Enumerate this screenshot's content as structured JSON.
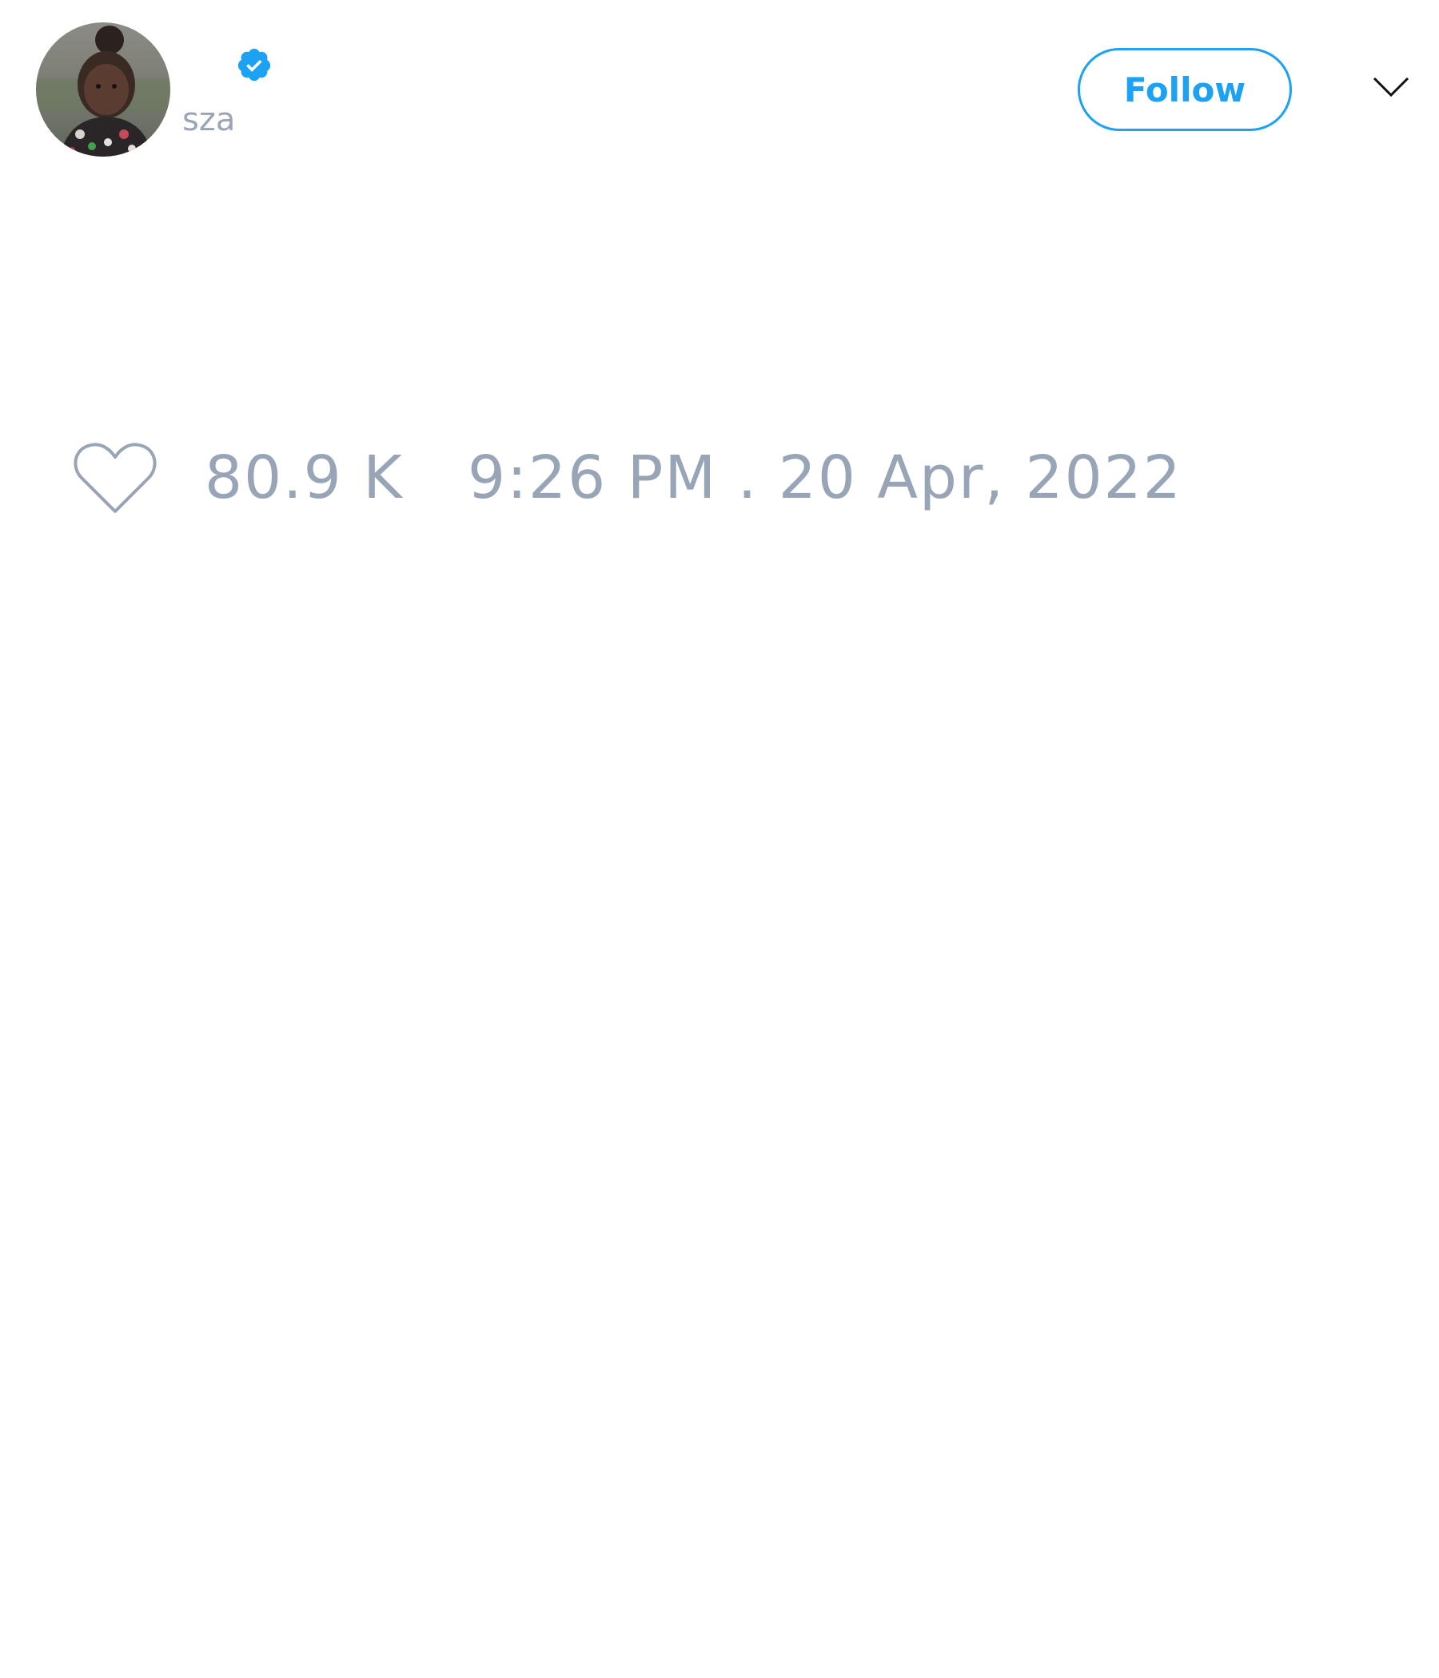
{
  "tweet": {
    "author": {
      "handle": "sza",
      "verified": true,
      "avatar_icon": "profile-photo"
    },
    "follow_button_label": "Follow",
    "menu_icon": "chevron-down-icon",
    "like_icon": "heart-outline-icon",
    "like_count": "80.9 K",
    "timestamp": "9:26 PM . 20 Apr, 2022"
  },
  "colors": {
    "accent": "#1da1f2",
    "muted_text": "#98a5b6",
    "background": "#ffffff"
  }
}
